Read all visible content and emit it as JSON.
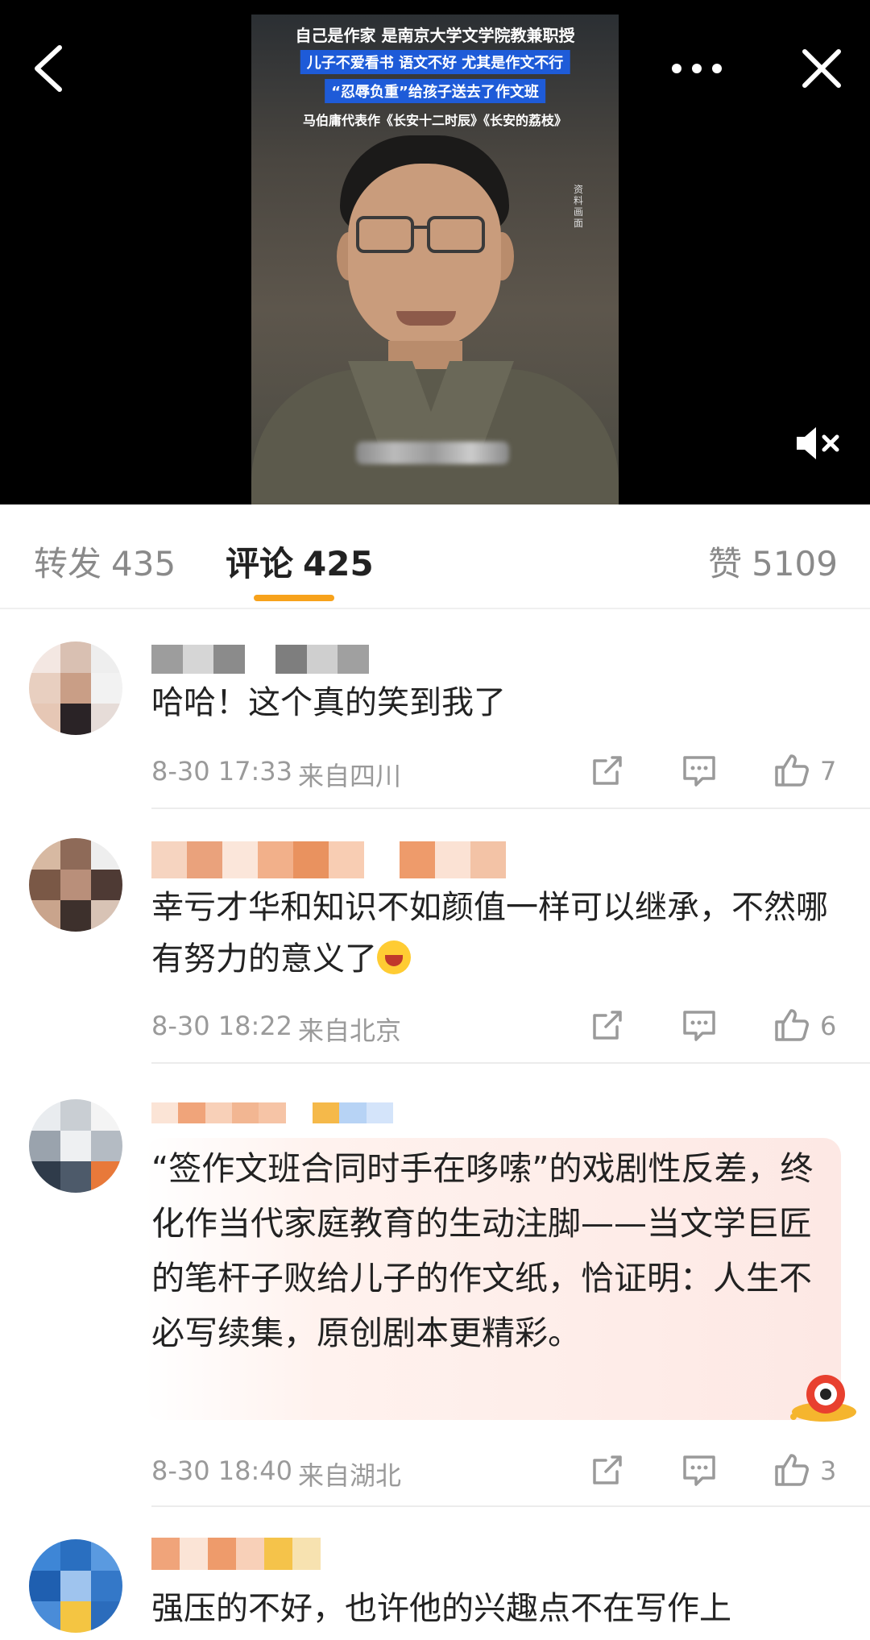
{
  "video": {
    "captions": [
      "自己是作家 是南京大学文学院教兼职授",
      "儿子不爱看书 语文不好 尤其是作文不行",
      "“忍辱负重”给孩子送去了作文班",
      "马伯庸代表作《长安十二时辰》《长安的荔枝》"
    ],
    "side_label": "资料画面"
  },
  "tabs": {
    "repost_label": "转发",
    "repost_count": "435",
    "comment_label": "评论",
    "comment_count": "425",
    "like_label": "赞",
    "like_count": "5109",
    "accent": "#f7a21b"
  },
  "comments": [
    {
      "text": "哈哈！这个真的笑到我了",
      "time": "8-30 17:33",
      "location": "来自四川",
      "likes": "7"
    },
    {
      "text": "幸亏才华和知识不如颜值一样可以继承，不然哪有努力的意义了",
      "time": "8-30 18:22",
      "location": "来自北京",
      "likes": "6"
    },
    {
      "text": "“签作文班合同时手在哆嗦”的戏剧性反差，终化作当代家庭教育的生动注脚——当文学巨匠的笔杆子败给儿子的作文纸，恰证明：人生不必写续集，原创剧本更精彩。",
      "time": "8-30 18:40",
      "location": "来自湖北",
      "likes": "3"
    },
    {
      "text": "强压的不好，也许他的兴趣点不在写作上"
    }
  ],
  "icons": {
    "back": "chevron-left-icon",
    "more": "more-dots-icon",
    "close": "close-icon",
    "mute": "mute-icon",
    "share": "share-icon",
    "reply": "comment-icon",
    "like": "thumb-up-icon"
  }
}
